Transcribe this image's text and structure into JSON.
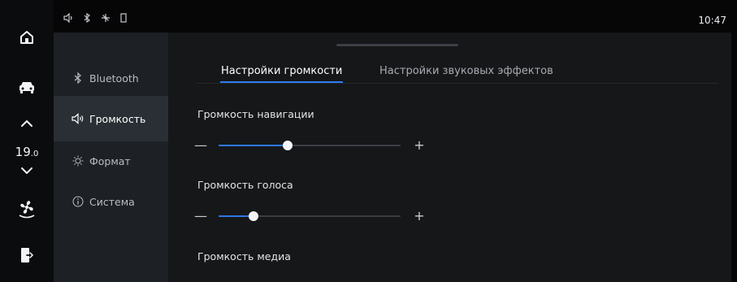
{
  "status_bar": {
    "clock": "10:47",
    "icons": [
      "sound-icon",
      "bluetooth-icon",
      "fan-status-icon",
      "battery-icon"
    ]
  },
  "left_rail": {
    "temperature": {
      "integer": "19",
      "decimal": ".0"
    },
    "icons": [
      "home-icon",
      "car-icon",
      "temp-up-icon",
      "temp-down-icon",
      "fan-icon",
      "exit-icon"
    ]
  },
  "menu": {
    "items": [
      {
        "label": "Bluetooth",
        "icon": "bluetooth-icon",
        "active": false
      },
      {
        "label": "Громкость",
        "icon": "volume-icon",
        "active": true
      },
      {
        "label": "Формат",
        "icon": "sun-icon",
        "active": false
      },
      {
        "label": "Система",
        "icon": "info-icon",
        "active": false
      }
    ]
  },
  "tabs": [
    {
      "label": "Настройки громкости",
      "active": true
    },
    {
      "label": "Настройки звуковых эффектов",
      "active": false
    }
  ],
  "settings": [
    {
      "label": "Громкость навигации",
      "level": 0.38,
      "minus": "—",
      "plus": "+"
    },
    {
      "label": "Громкость голоса",
      "level": 0.19,
      "minus": "—",
      "plus": "+"
    },
    {
      "label": "Громкость медиа"
    }
  ],
  "colors": {
    "accent": "#2f7df0",
    "menu_bg": "#1d2024",
    "menu_active_bg": "#2a2f35",
    "panel_bg": "#151719",
    "rail_bg": "#0b0c0e"
  }
}
